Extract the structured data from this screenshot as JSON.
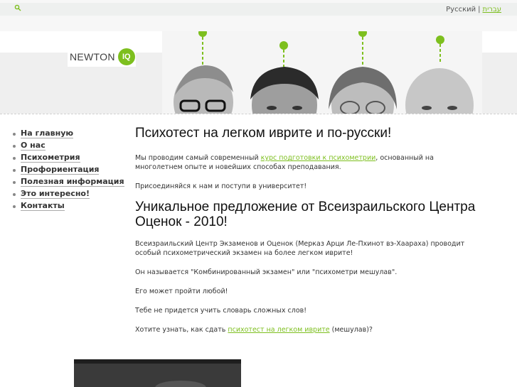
{
  "topbar": {
    "lang_current": "Русский",
    "lang_separator": "|",
    "lang_other": "עברית"
  },
  "logo": {
    "text": "NEWTON",
    "badge": "IQ"
  },
  "nav": {
    "items": [
      {
        "label": "На главную"
      },
      {
        "label": "О нас"
      },
      {
        "label": "Психометрия"
      },
      {
        "label": "Профориентация"
      },
      {
        "label": "Полезная информация"
      },
      {
        "label": "Это интересно!"
      },
      {
        "label": "Контакты"
      }
    ]
  },
  "main": {
    "title": "Психотест на легком иврите и по-русски!",
    "p1_before": "Мы проводим самый современный ",
    "p1_link": "курс подготовки к психометрии",
    "p1_after": ", основанный на многолетнем опыте и новейших способах преподавания.",
    "p2": "Присоединяйся к нам и поступи в университет!",
    "subtitle": "Уникальное предложение от Всеизраильского Центра Оценок - 2010!",
    "p3": "Всеизраильский Центр Экзаменов и Оценок (Мерказ Арци Ле-Пхинот вэ-Хаараха) проводит особый психометрический экзамен на более легком иврите!",
    "p4": "Он называется \"Комбинированный экзамен\" или \"психометри мешулав\".",
    "p5": "Его может пройти любой!",
    "p6": "Тебе не придется учить словарь сложных слов!",
    "p7_before": "Хотите узнать, как сдать ",
    "p7_link": "психотест на легком иврите",
    "p7_after": " (мешулав)?"
  },
  "colors": {
    "accent": "#7dbf1e"
  },
  "icons": {
    "search": "search-icon",
    "apple": "apple-icon"
  }
}
